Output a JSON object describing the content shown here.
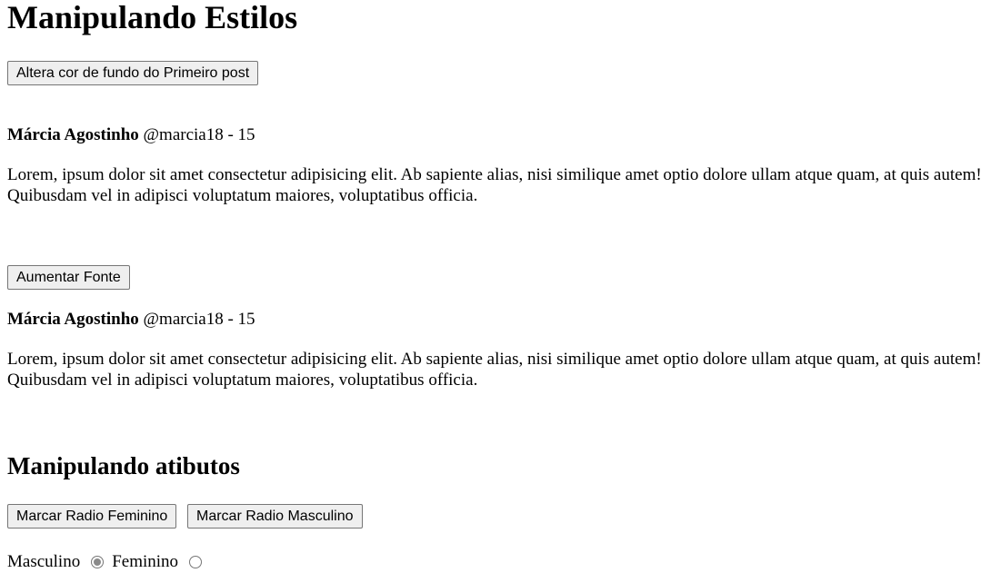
{
  "page": {
    "title": "Manipulando Estilos",
    "section2_title": "Manipulando atibutos"
  },
  "buttons": {
    "change_bg": "Altera cor de fundo do Primeiro post",
    "increase_font": "Aumentar Fonte",
    "mark_female": "Marcar Radio Feminino",
    "mark_male": "Marcar Radio Masculino"
  },
  "posts": [
    {
      "author": "Márcia Agostinho",
      "handle": "@marcia18 - 15",
      "body": "Lorem, ipsum dolor sit amet consectetur adipisicing elit. Ab sapiente alias, nisi similique amet optio dolore ullam atque quam, at quis autem! Quibusdam vel in adipisci voluptatum maiores, voluptatibus officia."
    },
    {
      "author": "Márcia Agostinho",
      "handle": "@marcia18 - 15",
      "body": "Lorem, ipsum dolor sit amet consectetur adipisicing elit. Ab sapiente alias, nisi similique amet optio dolore ullam atque quam, at quis autem! Quibusdam vel in adipisci voluptatum maiores, voluptatibus officia."
    }
  ],
  "radios": {
    "male_label": "Masculino",
    "male_checked": true,
    "female_label": "Feminino",
    "female_checked": false
  }
}
